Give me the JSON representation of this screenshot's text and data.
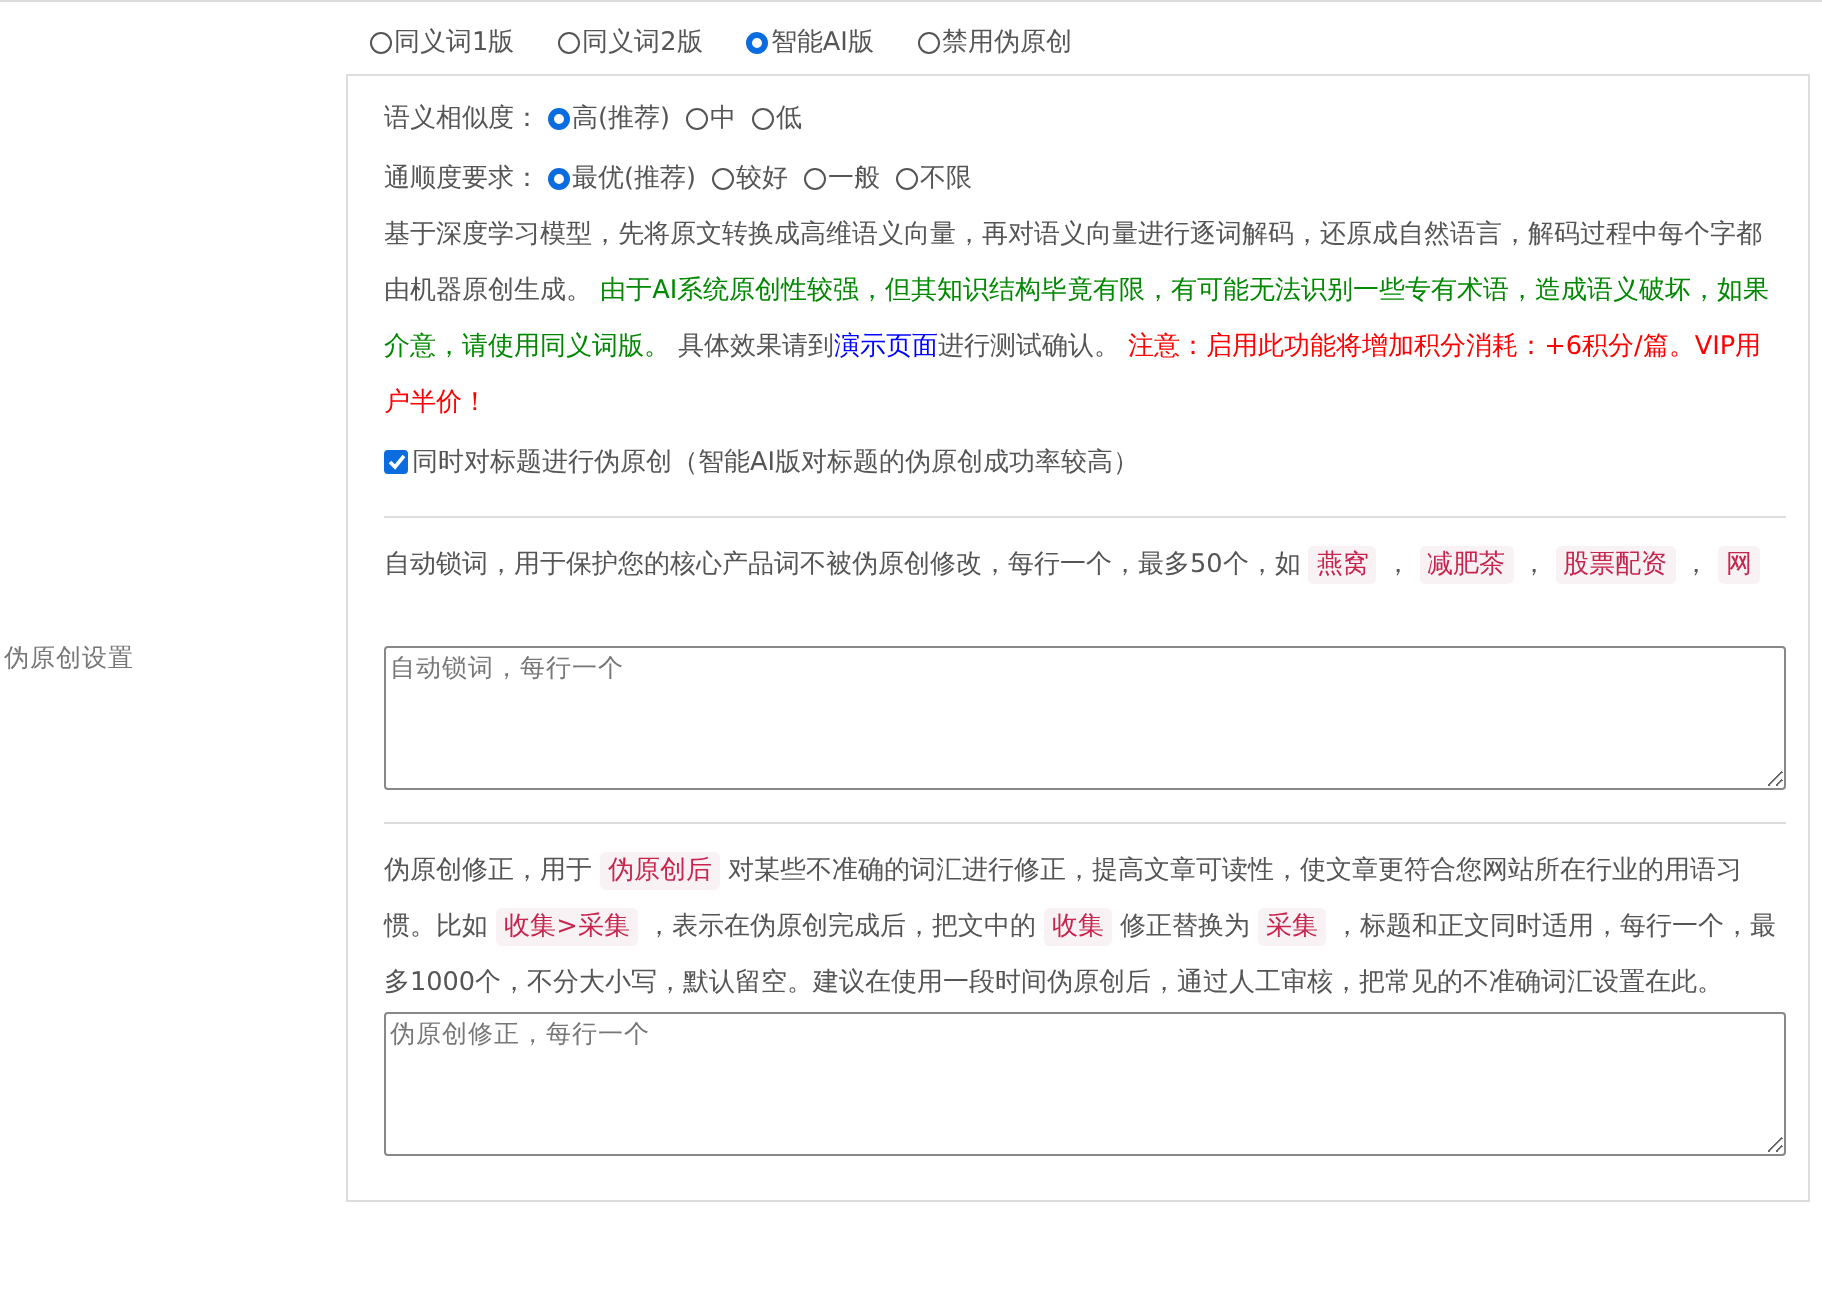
{
  "modes": [
    {
      "label": "同义词1版",
      "selected": false
    },
    {
      "label": "同义词2版",
      "selected": false
    },
    {
      "label": "智能AI版",
      "selected": true
    },
    {
      "label": "禁用伪原创",
      "selected": false
    }
  ],
  "ai_panel": {
    "settings": [
      {
        "label": "语义相似度：",
        "options": [
          {
            "label": "高(推荐)",
            "selected": true
          },
          {
            "label": "中",
            "selected": false
          },
          {
            "label": "低",
            "selected": false
          }
        ]
      },
      {
        "label": "通顺度要求：",
        "options": [
          {
            "label": "最优(推荐)",
            "selected": true
          },
          {
            "label": "较好",
            "selected": false
          },
          {
            "label": "一般",
            "selected": false
          },
          {
            "label": "不限",
            "selected": false
          }
        ]
      }
    ],
    "description": [
      {
        "kind": "plain",
        "text": "基于深度学习模型，先将原文转换成高维语义向量，再对语义向量进行逐词解码，还原成自然语言，解码过程中每个字都由机器原创生成。 "
      },
      {
        "kind": "notice",
        "text": "由于AI系统原创性较强，但其知识结构毕竟有限，有可能无法识别一些专有术语，造成语义破坏，如果介意，请使用同义词版。"
      },
      {
        "kind": "plain",
        "text": " 具体效果请到"
      },
      {
        "kind": "link",
        "text": "演示页面"
      },
      {
        "kind": "plain",
        "text": "进行测试确认。 "
      },
      {
        "kind": "warning",
        "text": "注意：启用此功能将增加积分消耗：+6积分/篇。VIP用户半价！"
      }
    ],
    "title_option": {
      "label": "同时对标题进行伪原创（智能AI版对标题的伪原创成功率较高）",
      "checked": true
    }
  },
  "side_label": "伪原创设置",
  "lock_words": {
    "description": [
      {
        "kind": "plain",
        "text": "自动锁词，用于保护您的核心产品词不被伪原创修改，每行一个，最多50个，如 "
      },
      {
        "kind": "code",
        "text": "燕窝"
      },
      {
        "kind": "plain",
        "text": " ， "
      },
      {
        "kind": "code",
        "text": "减肥茶"
      },
      {
        "kind": "plain",
        "text": " ， "
      },
      {
        "kind": "code",
        "text": "股票配资"
      },
      {
        "kind": "plain",
        "text": " ， "
      },
      {
        "kind": "code",
        "text": "网"
      }
    ],
    "placeholder": "自动锁词，每行一个"
  },
  "corrections": {
    "description": [
      {
        "kind": "plain",
        "text": "伪原创修正，用于 "
      },
      {
        "kind": "code",
        "text": "伪原创后"
      },
      {
        "kind": "plain",
        "text": " 对某些不准确的词汇进行修正，提高文章可读性，使文章更符合您网站所在行业的用语习惯。比如 "
      },
      {
        "kind": "code",
        "text": "收集>采集"
      },
      {
        "kind": "plain",
        "text": " ，表示在伪原创完成后，把文中的 "
      },
      {
        "kind": "code",
        "text": "收集"
      },
      {
        "kind": "plain",
        "text": " 修正替换为 "
      },
      {
        "kind": "code",
        "text": "采集"
      },
      {
        "kind": "plain",
        "text": " ，标题和正文同时适用，每行一个，最多1000个，不分大小写，默认留空。建议在使用一段时间伪原创后，通过人工审核，把常见的不准确词汇设置在此。"
      }
    ],
    "placeholder": "伪原创修正，每行一个"
  }
}
